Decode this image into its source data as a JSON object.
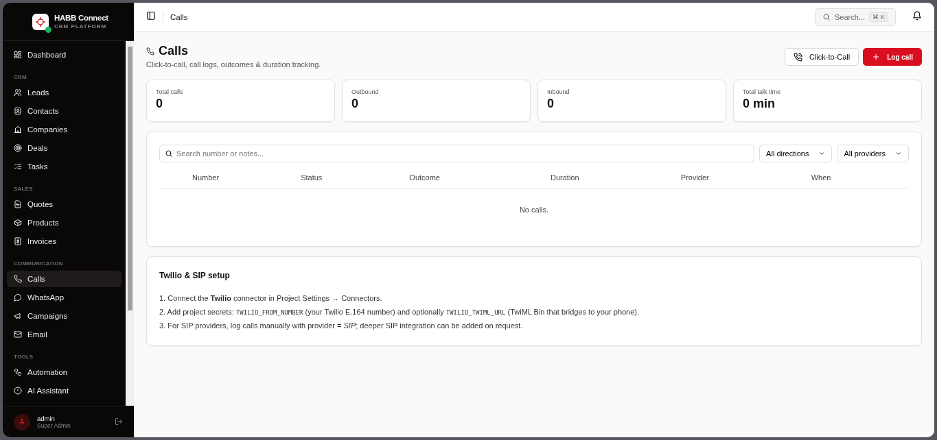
{
  "brand": {
    "name": "HABB Connect",
    "subtitle": "CRM PLATFORM",
    "online": true
  },
  "sidebar": {
    "sections": [
      {
        "items": [
          {
            "label": "Dashboard",
            "selected": false
          }
        ]
      },
      {
        "heading": "CRM",
        "items": [
          {
            "label": "Leads",
            "selected": false
          },
          {
            "label": "Contacts",
            "selected": false
          },
          {
            "label": "Companies",
            "selected": false
          },
          {
            "label": "Deals",
            "selected": false
          },
          {
            "label": "Tasks",
            "selected": false
          }
        ]
      },
      {
        "heading": "SALES",
        "items": [
          {
            "label": "Quotes",
            "selected": false
          },
          {
            "label": "Products",
            "selected": false
          },
          {
            "label": "Invoices",
            "selected": false
          }
        ]
      },
      {
        "heading": "COMMUNICATION",
        "items": [
          {
            "label": "Calls",
            "selected": true
          },
          {
            "label": "WhatsApp",
            "selected": false
          },
          {
            "label": "Campaigns",
            "selected": false
          },
          {
            "label": "Email",
            "selected": false
          }
        ]
      },
      {
        "heading": "TOOLS",
        "items": [
          {
            "label": "Automation",
            "selected": false
          },
          {
            "label": "AI Assistant",
            "selected": false
          }
        ]
      }
    ]
  },
  "user": {
    "initial": "A",
    "name": "admin",
    "role": "Super Admin"
  },
  "topbar": {
    "breadcrumb": "Calls",
    "search": {
      "placeholder": "Search...",
      "shortcut_symbol": "⌘",
      "shortcut_key": "K"
    }
  },
  "page": {
    "title": "Calls",
    "subtitle": "Click-to-call, call logs, outcomes & duration tracking.",
    "buttons": [
      {
        "label": "Click-to-Call",
        "kind": "outline"
      },
      {
        "label": "Log call",
        "kind": "primary"
      }
    ]
  },
  "stats": [
    {
      "label": "Total calls",
      "value": "0"
    },
    {
      "label": "Outbound",
      "value": "0"
    },
    {
      "label": "Inbound",
      "value": "0"
    },
    {
      "label": "Total talk time",
      "value": "0 min"
    }
  ],
  "filters": {
    "search": {
      "placeholder": "Search number or notes..."
    },
    "dropdowns": [
      "All directions",
      "All providers"
    ]
  },
  "table": {
    "columns": [
      "Number",
      "Status",
      "Outcome",
      "Duration",
      "Provider",
      "When"
    ],
    "empty": "No calls."
  },
  "setup": {
    "title": "Twilio & SIP setup",
    "lines": [
      [
        {
          "kind": "text",
          "text": "1. Connect the **Twilio** connector in Project Settings → Connectors."
        }
      ],
      [
        {
          "kind": "text",
          "text": "2. Add project secrets: "
        },
        {
          "kind": "code",
          "text": "TWILIO_FROM_NUMBER"
        },
        {
          "kind": "text",
          "text": " (your Twilio E.164 number) and optionally "
        },
        {
          "kind": "code",
          "text": "TWILIO_TWIML_URL"
        },
        {
          "kind": "text",
          "text": " (TwiML Bin that bridges to your phone)."
        }
      ],
      [
        {
          "kind": "text",
          "text": "3. For SIP providers, log calls manually with provider = *SIP*; deeper SIP integration can be added on request."
        }
      ]
    ]
  }
}
